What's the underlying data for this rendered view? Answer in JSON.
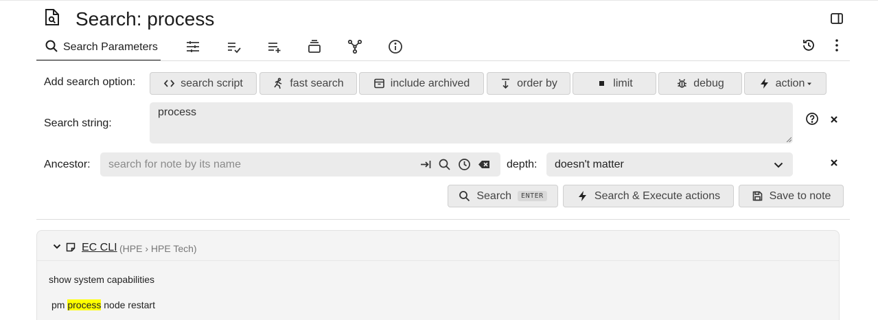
{
  "header": {
    "title": "Search: process",
    "note_icon": "search-note-icon",
    "panel_toggle_icon": "sidebar-toggle-icon"
  },
  "ribbon": {
    "active_tab_label": "Search Parameters",
    "active_tab_icon": "search-icon",
    "other_tab_icons": [
      "sliders-icon",
      "list-check-icon",
      "list-add-icon",
      "stack-icon",
      "graph-icon",
      "info-icon"
    ],
    "right_icons": [
      "history-icon",
      "more-vertical-icon"
    ]
  },
  "options": {
    "label": "Add search option:",
    "buttons": [
      {
        "label": "search script",
        "icon": "code-icon"
      },
      {
        "label": "fast search",
        "icon": "run-icon"
      },
      {
        "label": "include archived",
        "icon": "archive-icon"
      },
      {
        "label": "order by",
        "icon": "sort-down-icon"
      },
      {
        "label": "limit",
        "icon": "square-icon"
      },
      {
        "label": "debug",
        "icon": "bug-icon"
      },
      {
        "label": "action",
        "icon": "bolt-icon"
      }
    ]
  },
  "search_string": {
    "label": "Search string:",
    "value": "process"
  },
  "ancestor": {
    "label": "Ancestor:",
    "placeholder": "search for note by its name",
    "depth_label": "depth:",
    "depth_value": "doesn't matter"
  },
  "actions": {
    "search_label": "Search",
    "search_kbd": "ENTER",
    "execute_label": "Search & Execute actions",
    "save_label": "Save to note"
  },
  "result": {
    "title": "EC CLI",
    "path": "(HPE › HPE Tech)",
    "lines": [
      "show system capabilities"
    ],
    "match_prefix": "pm ",
    "match_highlight": "process",
    "match_suffix": " node restart"
  }
}
